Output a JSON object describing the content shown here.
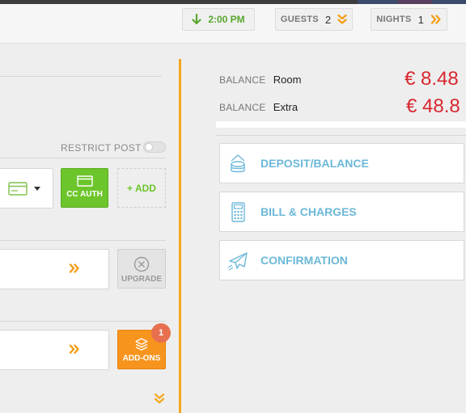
{
  "header": {
    "time": "2:00 PM",
    "guests_label": "GUESTS",
    "guests_value": "2",
    "nights_label": "NIGHTS",
    "nights_value": "1"
  },
  "left": {
    "restrict_post": "RESTRICT POST",
    "cc_auth": "CC AUTH",
    "add": "+ ADD",
    "upgrade": "UPGRADE",
    "addons": "ADD-ONS",
    "addons_badge": "1"
  },
  "balance": {
    "rows": [
      {
        "key": "BALANCE",
        "value": "Room",
        "amount": "€ 8.48"
      },
      {
        "key": "BALANCE",
        "value": "Extra",
        "amount": "€ 48.8"
      }
    ]
  },
  "actions": [
    {
      "label": "DEPOSIT/BALANCE",
      "icon": "coins-icon"
    },
    {
      "label": "BILL & CHARGES",
      "icon": "calculator-icon"
    },
    {
      "label": "CONFIRMATION",
      "icon": "paper-plane-icon"
    }
  ],
  "colors": {
    "accent": "#f3a81a",
    "green": "#6cc52a",
    "orange": "#f7941d",
    "amount_red": "#d9262e",
    "link_blue": "#6cb8d8"
  }
}
